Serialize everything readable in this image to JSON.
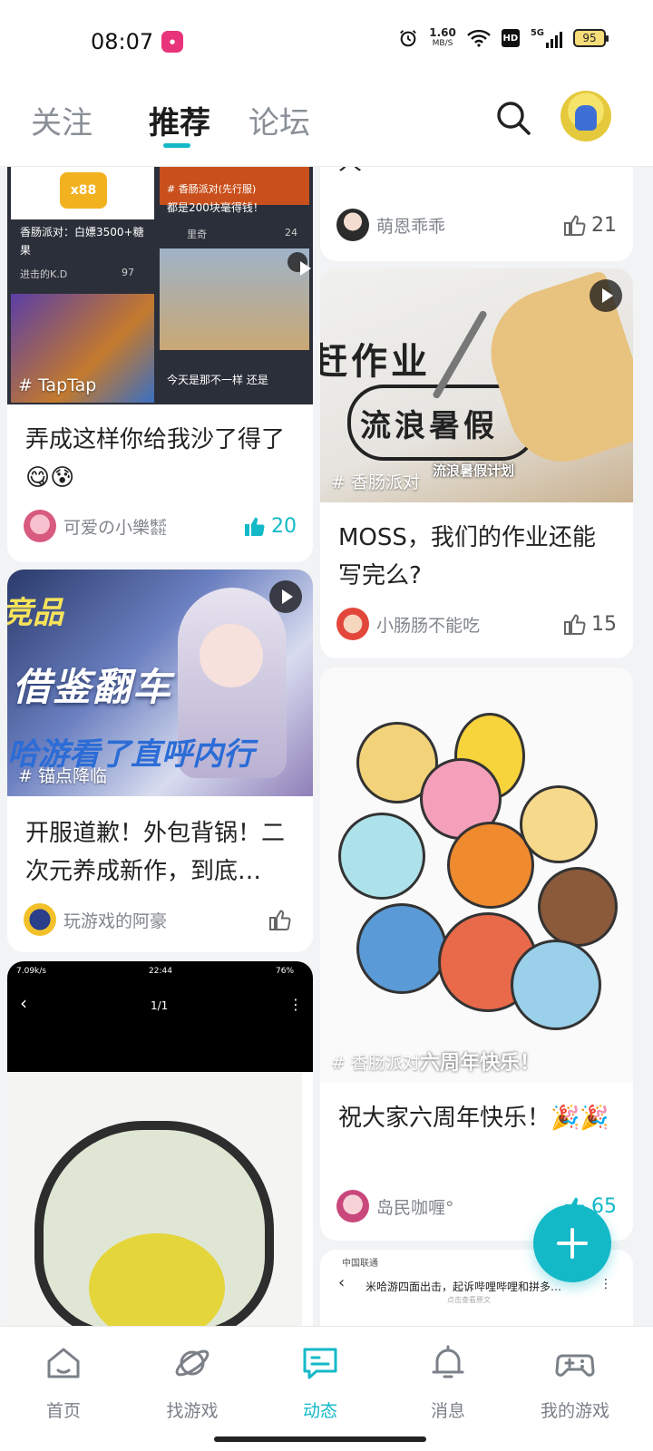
{
  "status_bar": {
    "time": "08:07",
    "net_speed": "1.60",
    "net_unit": "MB/S",
    "hd": "HD",
    "signal": "5G",
    "battery": "95",
    "icons": [
      "app-notification-icon",
      "alarm-icon",
      "wifi-icon",
      "hd-icon",
      "signal-icon",
      "battery-icon"
    ]
  },
  "top_nav": {
    "tabs": [
      {
        "label": "关注"
      },
      {
        "label": "推荐"
      },
      {
        "label": "论坛"
      }
    ],
    "active_tab": 1,
    "accent_color": "#14b9c8"
  },
  "feed": {
    "left": [
      {
        "tag": "# TapTap",
        "title": "弄成这样你给我沙了得了😋😰",
        "author": "可爱の小樂㍿",
        "likes": "20",
        "liked": true,
        "thumb_texts": [
          "x88",
          "香肠派对：白嫖3500+糖果",
          "进击的K.D",
          "97",
          "# 香肠派对(先行服)",
          "都是200块毫得钱！",
          "里奇",
          "24",
          "今天是那不一样 还是"
        ]
      },
      {
        "tag": "# 锚点降临",
        "title": "开服道歉！外包背锅！二次元养成新作，到底…",
        "author": "玩游戏的阿豪",
        "likes": "",
        "liked": false,
        "thumb_texts": [
          "借鉴翻车",
          "哈游看了直呼内行",
          "竞品"
        ]
      },
      {
        "thumb_texts": [
          "7.09k/s",
          "22:44",
          "76%",
          "1/1"
        ]
      }
    ],
    "right": [
      {
        "title": "人",
        "author": "萌恩乖乖",
        "likes": "21",
        "liked": false
      },
      {
        "tag": "# 香肠派对",
        "title": "MOSS，我们的作业还能写完么?",
        "author": "小肠肠不能吃",
        "likes": "15",
        "liked": false,
        "thumb_texts": [
          "赶作业",
          "流浪暑假",
          "流浪暑假计划"
        ]
      },
      {
        "tag": "# 香肠派对",
        "title": "祝大家六周年快乐！🎉🎉",
        "author": "岛民咖喱°",
        "likes": "65",
        "liked": true,
        "thumb_texts": [
          "六周年快乐！"
        ]
      },
      {
        "thumb_texts": [
          "中国联通",
          "米哈游四面出击，起诉哔哩哔哩和拼多…",
          "点击查看原文"
        ]
      }
    ]
  },
  "fab": {
    "icon": "plus-icon"
  },
  "bottom_nav": {
    "items": [
      {
        "label": "首页",
        "icon": "home-icon"
      },
      {
        "label": "找游戏",
        "icon": "planet-icon"
      },
      {
        "label": "动态",
        "icon": "chat-icon"
      },
      {
        "label": "消息",
        "icon": "bell-icon"
      },
      {
        "label": "我的游戏",
        "icon": "gamepad-icon"
      }
    ],
    "active": 2
  }
}
